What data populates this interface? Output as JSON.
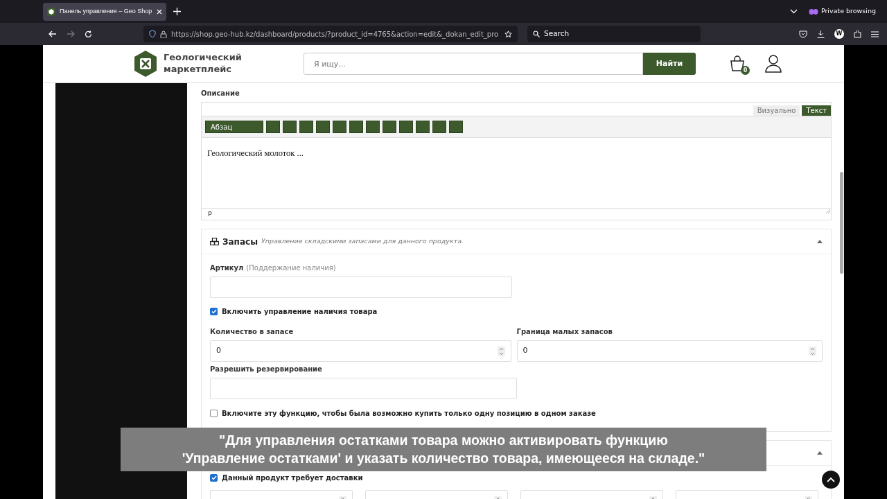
{
  "browser": {
    "tab_title": "Панель управления – Geo Shop",
    "url": "https://shop.geo-hub.kz/dashboard/products/?product_id=4765&action=edit&_dokan_edit_pro",
    "search_placeholder": "Search",
    "private_label": "Private browsing",
    "profile_initial": "W"
  },
  "header": {
    "logo_line1": "Геологический",
    "logo_line2": "маркетплейс",
    "search_placeholder": "Я ищу...",
    "search_button": "Найти",
    "cart_count": "0"
  },
  "description": {
    "label": "Описание",
    "tabs": [
      {
        "label": "Визуально",
        "selected": false
      },
      {
        "label": "Текст",
        "selected": true
      }
    ],
    "format_select": "Абзац",
    "toolbar_buttons": [
      {
        "kind": "button"
      },
      {
        "kind": "button"
      },
      {
        "kind": "button"
      },
      {
        "kind": "button"
      },
      {
        "kind": "button"
      },
      {
        "kind": "button"
      },
      {
        "kind": "button"
      },
      {
        "kind": "button"
      },
      {
        "kind": "button"
      },
      {
        "kind": "button"
      },
      {
        "kind": "button"
      },
      {
        "kind": "button"
      }
    ],
    "content": "Геологический молоток ...",
    "path": "P"
  },
  "inventory": {
    "title": "Запасы",
    "subtitle": "Управление складскими запасами для данного продукта.",
    "expanded": true,
    "sku_label": "Артикул",
    "sku_hint": "(Поддержание наличия)",
    "manage_stock": {
      "label": "Включить управление наличия товара",
      "checked": true
    },
    "stock_qty": {
      "label": "Количество в запасе",
      "value": "0"
    },
    "low_stock": {
      "label": "Граница малых запасов",
      "value": "0"
    },
    "backorders": {
      "label": "Разрешить резервирование"
    },
    "sold_individually": {
      "label": "Включите эту функцию, чтобы была возможно купить только одну позицию в одном заказе",
      "checked": false
    }
  },
  "shipping": {
    "expanded": true,
    "requires_shipping": {
      "label": "Данный продукт требует доставки",
      "checked": true
    },
    "fields": [
      {
        "kind": "number"
      },
      {
        "kind": "number"
      },
      {
        "kind": "number"
      },
      {
        "kind": "number"
      }
    ]
  },
  "caption": {
    "lines": [
      "\"Для управления остатками товара можно активировать функцию",
      "'Управление остатками' и указать количество товара, имеющееся на складе.\""
    ]
  }
}
